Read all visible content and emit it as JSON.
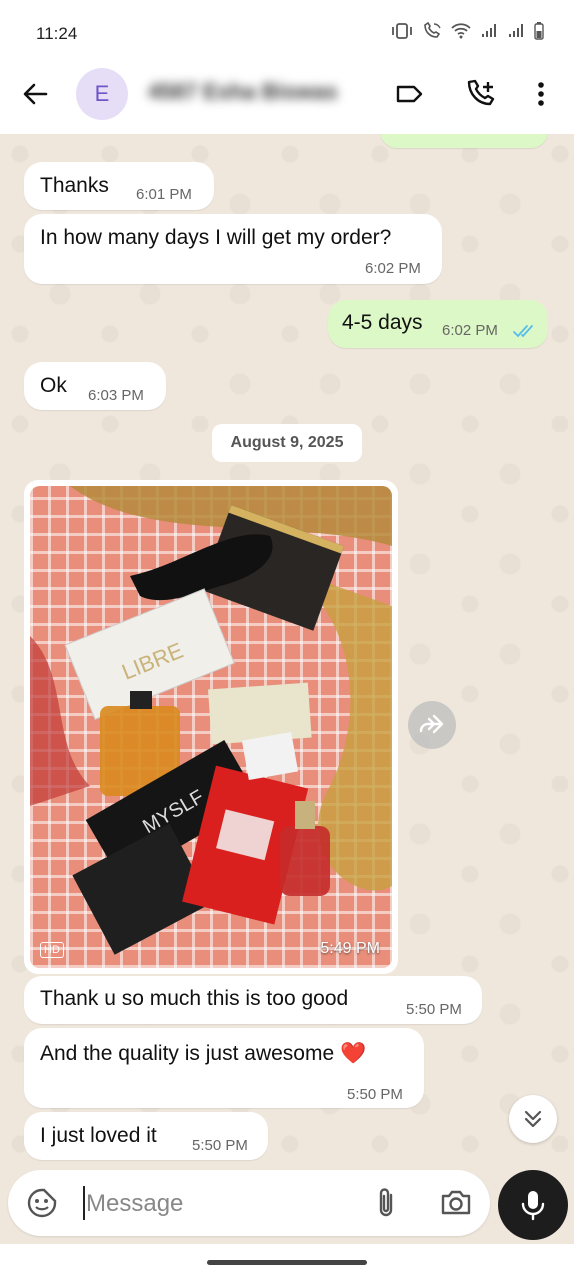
{
  "status_bar": {
    "time": "11:24"
  },
  "header": {
    "avatar_letter": "E",
    "contact_name": "4587 Esha Biswas"
  },
  "messages": [
    {
      "text": "Thanks",
      "time": "6:01 PM"
    },
    {
      "text": "In how many days I will get my order?",
      "time": "6:02 PM"
    },
    {
      "text": "4-5 days",
      "time": "6:02 PM"
    },
    {
      "text": "Ok",
      "time": "6:03 PM"
    }
  ],
  "date_separator": "August 9, 2025",
  "photo": {
    "time": "5:49 PM",
    "hd_label": "HD"
  },
  "messages_after": [
    {
      "text": "Thank u so much this is too good",
      "time": "5:50 PM"
    },
    {
      "text": "And the quality is just awesome ❤️",
      "time": "5:50 PM"
    },
    {
      "text": "I just loved it",
      "time": "5:50 PM"
    }
  ],
  "input": {
    "placeholder": "Message"
  },
  "colors": {
    "outgoing_bubble": "#dcf8c6",
    "incoming_bubble": "#ffffff",
    "read_tick": "#53bdeb",
    "avatar_bg": "#e6def7"
  }
}
